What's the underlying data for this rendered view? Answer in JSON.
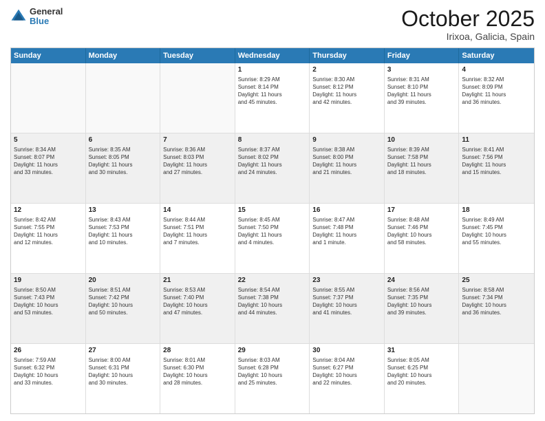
{
  "header": {
    "logo_line1": "General",
    "logo_line2": "Blue",
    "title": "October 2025",
    "subtitle": "Irixoa, Galicia, Spain"
  },
  "weekdays": [
    "Sunday",
    "Monday",
    "Tuesday",
    "Wednesday",
    "Thursday",
    "Friday",
    "Saturday"
  ],
  "rows": [
    [
      {
        "day": "",
        "lines": [],
        "empty": true
      },
      {
        "day": "",
        "lines": [],
        "empty": true
      },
      {
        "day": "",
        "lines": [],
        "empty": true
      },
      {
        "day": "1",
        "lines": [
          "Sunrise: 8:29 AM",
          "Sunset: 8:14 PM",
          "Daylight: 11 hours",
          "and 45 minutes."
        ]
      },
      {
        "day": "2",
        "lines": [
          "Sunrise: 8:30 AM",
          "Sunset: 8:12 PM",
          "Daylight: 11 hours",
          "and 42 minutes."
        ]
      },
      {
        "day": "3",
        "lines": [
          "Sunrise: 8:31 AM",
          "Sunset: 8:10 PM",
          "Daylight: 11 hours",
          "and 39 minutes."
        ]
      },
      {
        "day": "4",
        "lines": [
          "Sunrise: 8:32 AM",
          "Sunset: 8:09 PM",
          "Daylight: 11 hours",
          "and 36 minutes."
        ]
      }
    ],
    [
      {
        "day": "5",
        "lines": [
          "Sunrise: 8:34 AM",
          "Sunset: 8:07 PM",
          "Daylight: 11 hours",
          "and 33 minutes."
        ],
        "shaded": true
      },
      {
        "day": "6",
        "lines": [
          "Sunrise: 8:35 AM",
          "Sunset: 8:05 PM",
          "Daylight: 11 hours",
          "and 30 minutes."
        ],
        "shaded": true
      },
      {
        "day": "7",
        "lines": [
          "Sunrise: 8:36 AM",
          "Sunset: 8:03 PM",
          "Daylight: 11 hours",
          "and 27 minutes."
        ],
        "shaded": true
      },
      {
        "day": "8",
        "lines": [
          "Sunrise: 8:37 AM",
          "Sunset: 8:02 PM",
          "Daylight: 11 hours",
          "and 24 minutes."
        ],
        "shaded": true
      },
      {
        "day": "9",
        "lines": [
          "Sunrise: 8:38 AM",
          "Sunset: 8:00 PM",
          "Daylight: 11 hours",
          "and 21 minutes."
        ],
        "shaded": true
      },
      {
        "day": "10",
        "lines": [
          "Sunrise: 8:39 AM",
          "Sunset: 7:58 PM",
          "Daylight: 11 hours",
          "and 18 minutes."
        ],
        "shaded": true
      },
      {
        "day": "11",
        "lines": [
          "Sunrise: 8:41 AM",
          "Sunset: 7:56 PM",
          "Daylight: 11 hours",
          "and 15 minutes."
        ],
        "shaded": true
      }
    ],
    [
      {
        "day": "12",
        "lines": [
          "Sunrise: 8:42 AM",
          "Sunset: 7:55 PM",
          "Daylight: 11 hours",
          "and 12 minutes."
        ]
      },
      {
        "day": "13",
        "lines": [
          "Sunrise: 8:43 AM",
          "Sunset: 7:53 PM",
          "Daylight: 11 hours",
          "and 10 minutes."
        ]
      },
      {
        "day": "14",
        "lines": [
          "Sunrise: 8:44 AM",
          "Sunset: 7:51 PM",
          "Daylight: 11 hours",
          "and 7 minutes."
        ]
      },
      {
        "day": "15",
        "lines": [
          "Sunrise: 8:45 AM",
          "Sunset: 7:50 PM",
          "Daylight: 11 hours",
          "and 4 minutes."
        ]
      },
      {
        "day": "16",
        "lines": [
          "Sunrise: 8:47 AM",
          "Sunset: 7:48 PM",
          "Daylight: 11 hours",
          "and 1 minute."
        ]
      },
      {
        "day": "17",
        "lines": [
          "Sunrise: 8:48 AM",
          "Sunset: 7:46 PM",
          "Daylight: 10 hours",
          "and 58 minutes."
        ]
      },
      {
        "day": "18",
        "lines": [
          "Sunrise: 8:49 AM",
          "Sunset: 7:45 PM",
          "Daylight: 10 hours",
          "and 55 minutes."
        ]
      }
    ],
    [
      {
        "day": "19",
        "lines": [
          "Sunrise: 8:50 AM",
          "Sunset: 7:43 PM",
          "Daylight: 10 hours",
          "and 53 minutes."
        ],
        "shaded": true
      },
      {
        "day": "20",
        "lines": [
          "Sunrise: 8:51 AM",
          "Sunset: 7:42 PM",
          "Daylight: 10 hours",
          "and 50 minutes."
        ],
        "shaded": true
      },
      {
        "day": "21",
        "lines": [
          "Sunrise: 8:53 AM",
          "Sunset: 7:40 PM",
          "Daylight: 10 hours",
          "and 47 minutes."
        ],
        "shaded": true
      },
      {
        "day": "22",
        "lines": [
          "Sunrise: 8:54 AM",
          "Sunset: 7:38 PM",
          "Daylight: 10 hours",
          "and 44 minutes."
        ],
        "shaded": true
      },
      {
        "day": "23",
        "lines": [
          "Sunrise: 8:55 AM",
          "Sunset: 7:37 PM",
          "Daylight: 10 hours",
          "and 41 minutes."
        ],
        "shaded": true
      },
      {
        "day": "24",
        "lines": [
          "Sunrise: 8:56 AM",
          "Sunset: 7:35 PM",
          "Daylight: 10 hours",
          "and 39 minutes."
        ],
        "shaded": true
      },
      {
        "day": "25",
        "lines": [
          "Sunrise: 8:58 AM",
          "Sunset: 7:34 PM",
          "Daylight: 10 hours",
          "and 36 minutes."
        ],
        "shaded": true
      }
    ],
    [
      {
        "day": "26",
        "lines": [
          "Sunrise: 7:59 AM",
          "Sunset: 6:32 PM",
          "Daylight: 10 hours",
          "and 33 minutes."
        ]
      },
      {
        "day": "27",
        "lines": [
          "Sunrise: 8:00 AM",
          "Sunset: 6:31 PM",
          "Daylight: 10 hours",
          "and 30 minutes."
        ]
      },
      {
        "day": "28",
        "lines": [
          "Sunrise: 8:01 AM",
          "Sunset: 6:30 PM",
          "Daylight: 10 hours",
          "and 28 minutes."
        ]
      },
      {
        "day": "29",
        "lines": [
          "Sunrise: 8:03 AM",
          "Sunset: 6:28 PM",
          "Daylight: 10 hours",
          "and 25 minutes."
        ]
      },
      {
        "day": "30",
        "lines": [
          "Sunrise: 8:04 AM",
          "Sunset: 6:27 PM",
          "Daylight: 10 hours",
          "and 22 minutes."
        ]
      },
      {
        "day": "31",
        "lines": [
          "Sunrise: 8:05 AM",
          "Sunset: 6:25 PM",
          "Daylight: 10 hours",
          "and 20 minutes."
        ]
      },
      {
        "day": "",
        "lines": [],
        "empty": true
      }
    ]
  ]
}
